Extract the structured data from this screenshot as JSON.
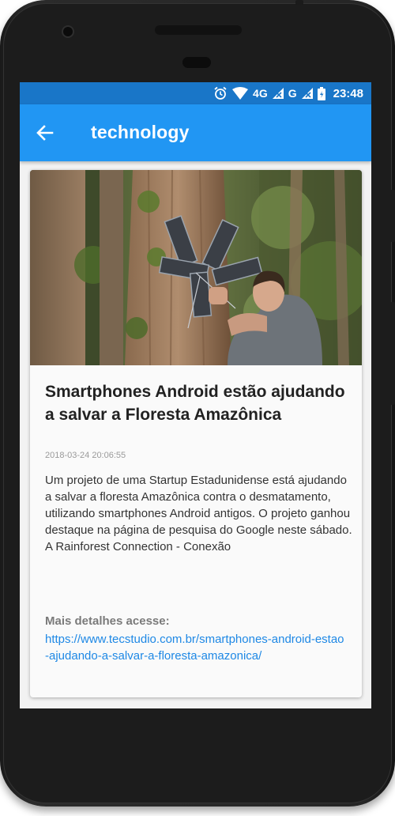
{
  "status_bar": {
    "network_1": "4G",
    "network_2": "G",
    "time": "23:48",
    "icons": [
      "alarm-icon",
      "wifi-icon",
      "signal-icon",
      "signal-icon",
      "battery-icon"
    ]
  },
  "app_bar": {
    "title": "technology",
    "back_icon": "arrow-left-icon",
    "background": "#2196f3",
    "status_background": "#1976c8"
  },
  "article": {
    "image_description": "man installing phone-based device on tree in forest",
    "title": "Smartphones Android estão ajudando a salvar a Floresta Amazônica",
    "date": "2018-03-24 20:06:55",
    "body": "Um projeto de uma Startup Estadunidense está ajudando a salvar a floresta Amazônica contra o desmatamento, utilizando smartphones Android antigos. O projeto ganhou destaque na página de pesquisa do Google neste sábado.    A Rainforest Connection - Conexão",
    "more_label": "Mais detalhes acesse:",
    "link": "https://www.tecstudio.com.br/smartphones-android-estao-ajudando-a-salvar-a-floresta-amazonica/",
    "link_color": "#1e88e5"
  }
}
